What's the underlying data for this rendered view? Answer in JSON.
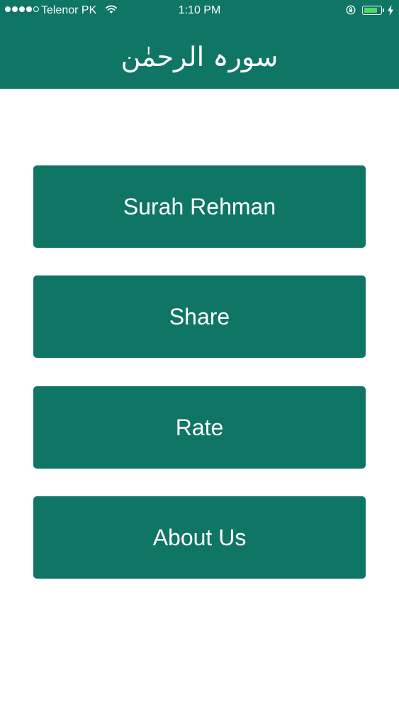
{
  "status_bar": {
    "carrier": "Telenor PK",
    "time": "1:10 PM",
    "signal_bars_filled": 4,
    "signal_bars_total": 5,
    "battery_level": 0.85,
    "battery_color": "#4cd964",
    "icons": [
      "signal-icon",
      "wifi-icon",
      "orientation-lock-icon",
      "battery-icon",
      "charging-bolt-icon"
    ]
  },
  "header": {
    "title": "سورہ الرحمٰن",
    "background_color": "#0f7565"
  },
  "menu": {
    "items": [
      {
        "label": "Surah Rehman"
      },
      {
        "label": "Share"
      },
      {
        "label": "Rate"
      },
      {
        "label": "About Us"
      }
    ],
    "button_color": "#0f7565"
  }
}
